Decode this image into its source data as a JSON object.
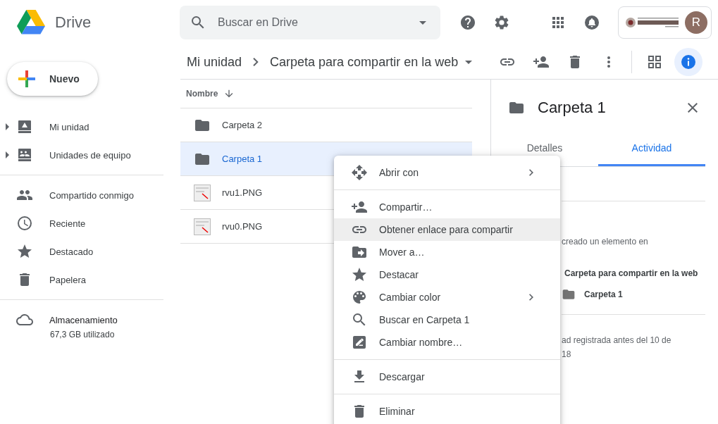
{
  "app": {
    "name": "Drive"
  },
  "search": {
    "placeholder": "Buscar en Drive"
  },
  "account": {
    "initial": "R"
  },
  "new_button": {
    "label": "Nuevo"
  },
  "sidebar": {
    "drives": [
      {
        "label": "Mi unidad"
      },
      {
        "label": "Unidades de equipo"
      }
    ],
    "items": [
      {
        "label": "Compartido conmigo"
      },
      {
        "label": "Reciente"
      },
      {
        "label": "Destacado"
      },
      {
        "label": "Papelera"
      }
    ],
    "storage": {
      "label": "Almacenamiento",
      "usage": "67,3 GB utilizado"
    }
  },
  "breadcrumb": [
    "Mi unidad",
    "Carpeta para compartir en la web"
  ],
  "file_list": {
    "column": "Nombre",
    "rows": [
      {
        "name": "Carpeta 2",
        "kind": "folder",
        "selected": false
      },
      {
        "name": "Carpeta 1",
        "kind": "folder",
        "selected": true
      },
      {
        "name": "rvu1.PNG",
        "kind": "image",
        "selected": false
      },
      {
        "name": "rvu0.PNG",
        "kind": "image",
        "selected": false
      }
    ]
  },
  "details_panel": {
    "title": "Carpeta 1",
    "tabs": [
      {
        "label": "Detalles",
        "selected": false
      },
      {
        "label": "Actividad",
        "selected": true
      }
    ],
    "activity": {
      "text": "creado un elemento en",
      "location": "Carpeta para compartir en la web",
      "item": "Carpeta 1",
      "note_lines": [
        "ad registrada antes del 10 de",
        "18"
      ]
    }
  },
  "context_menu": {
    "groups": [
      [
        {
          "label": "Abrir con",
          "submenu": true,
          "highlighted": false
        }
      ],
      [
        {
          "label": "Compartir…",
          "submenu": false,
          "highlighted": false
        },
        {
          "label": "Obtener enlace para compartir",
          "submenu": false,
          "highlighted": true
        },
        {
          "label": "Mover a…",
          "submenu": false,
          "highlighted": false
        },
        {
          "label": "Destacar",
          "submenu": false,
          "highlighted": false
        },
        {
          "label": "Cambiar color",
          "submenu": true,
          "highlighted": false
        },
        {
          "label": "Buscar en Carpeta 1",
          "submenu": false,
          "highlighted": false
        },
        {
          "label": "Cambiar nombre…",
          "submenu": false,
          "highlighted": false
        }
      ],
      [
        {
          "label": "Descargar",
          "submenu": false,
          "highlighted": false
        }
      ],
      [
        {
          "label": "Eliminar",
          "submenu": false,
          "highlighted": false
        }
      ]
    ]
  }
}
